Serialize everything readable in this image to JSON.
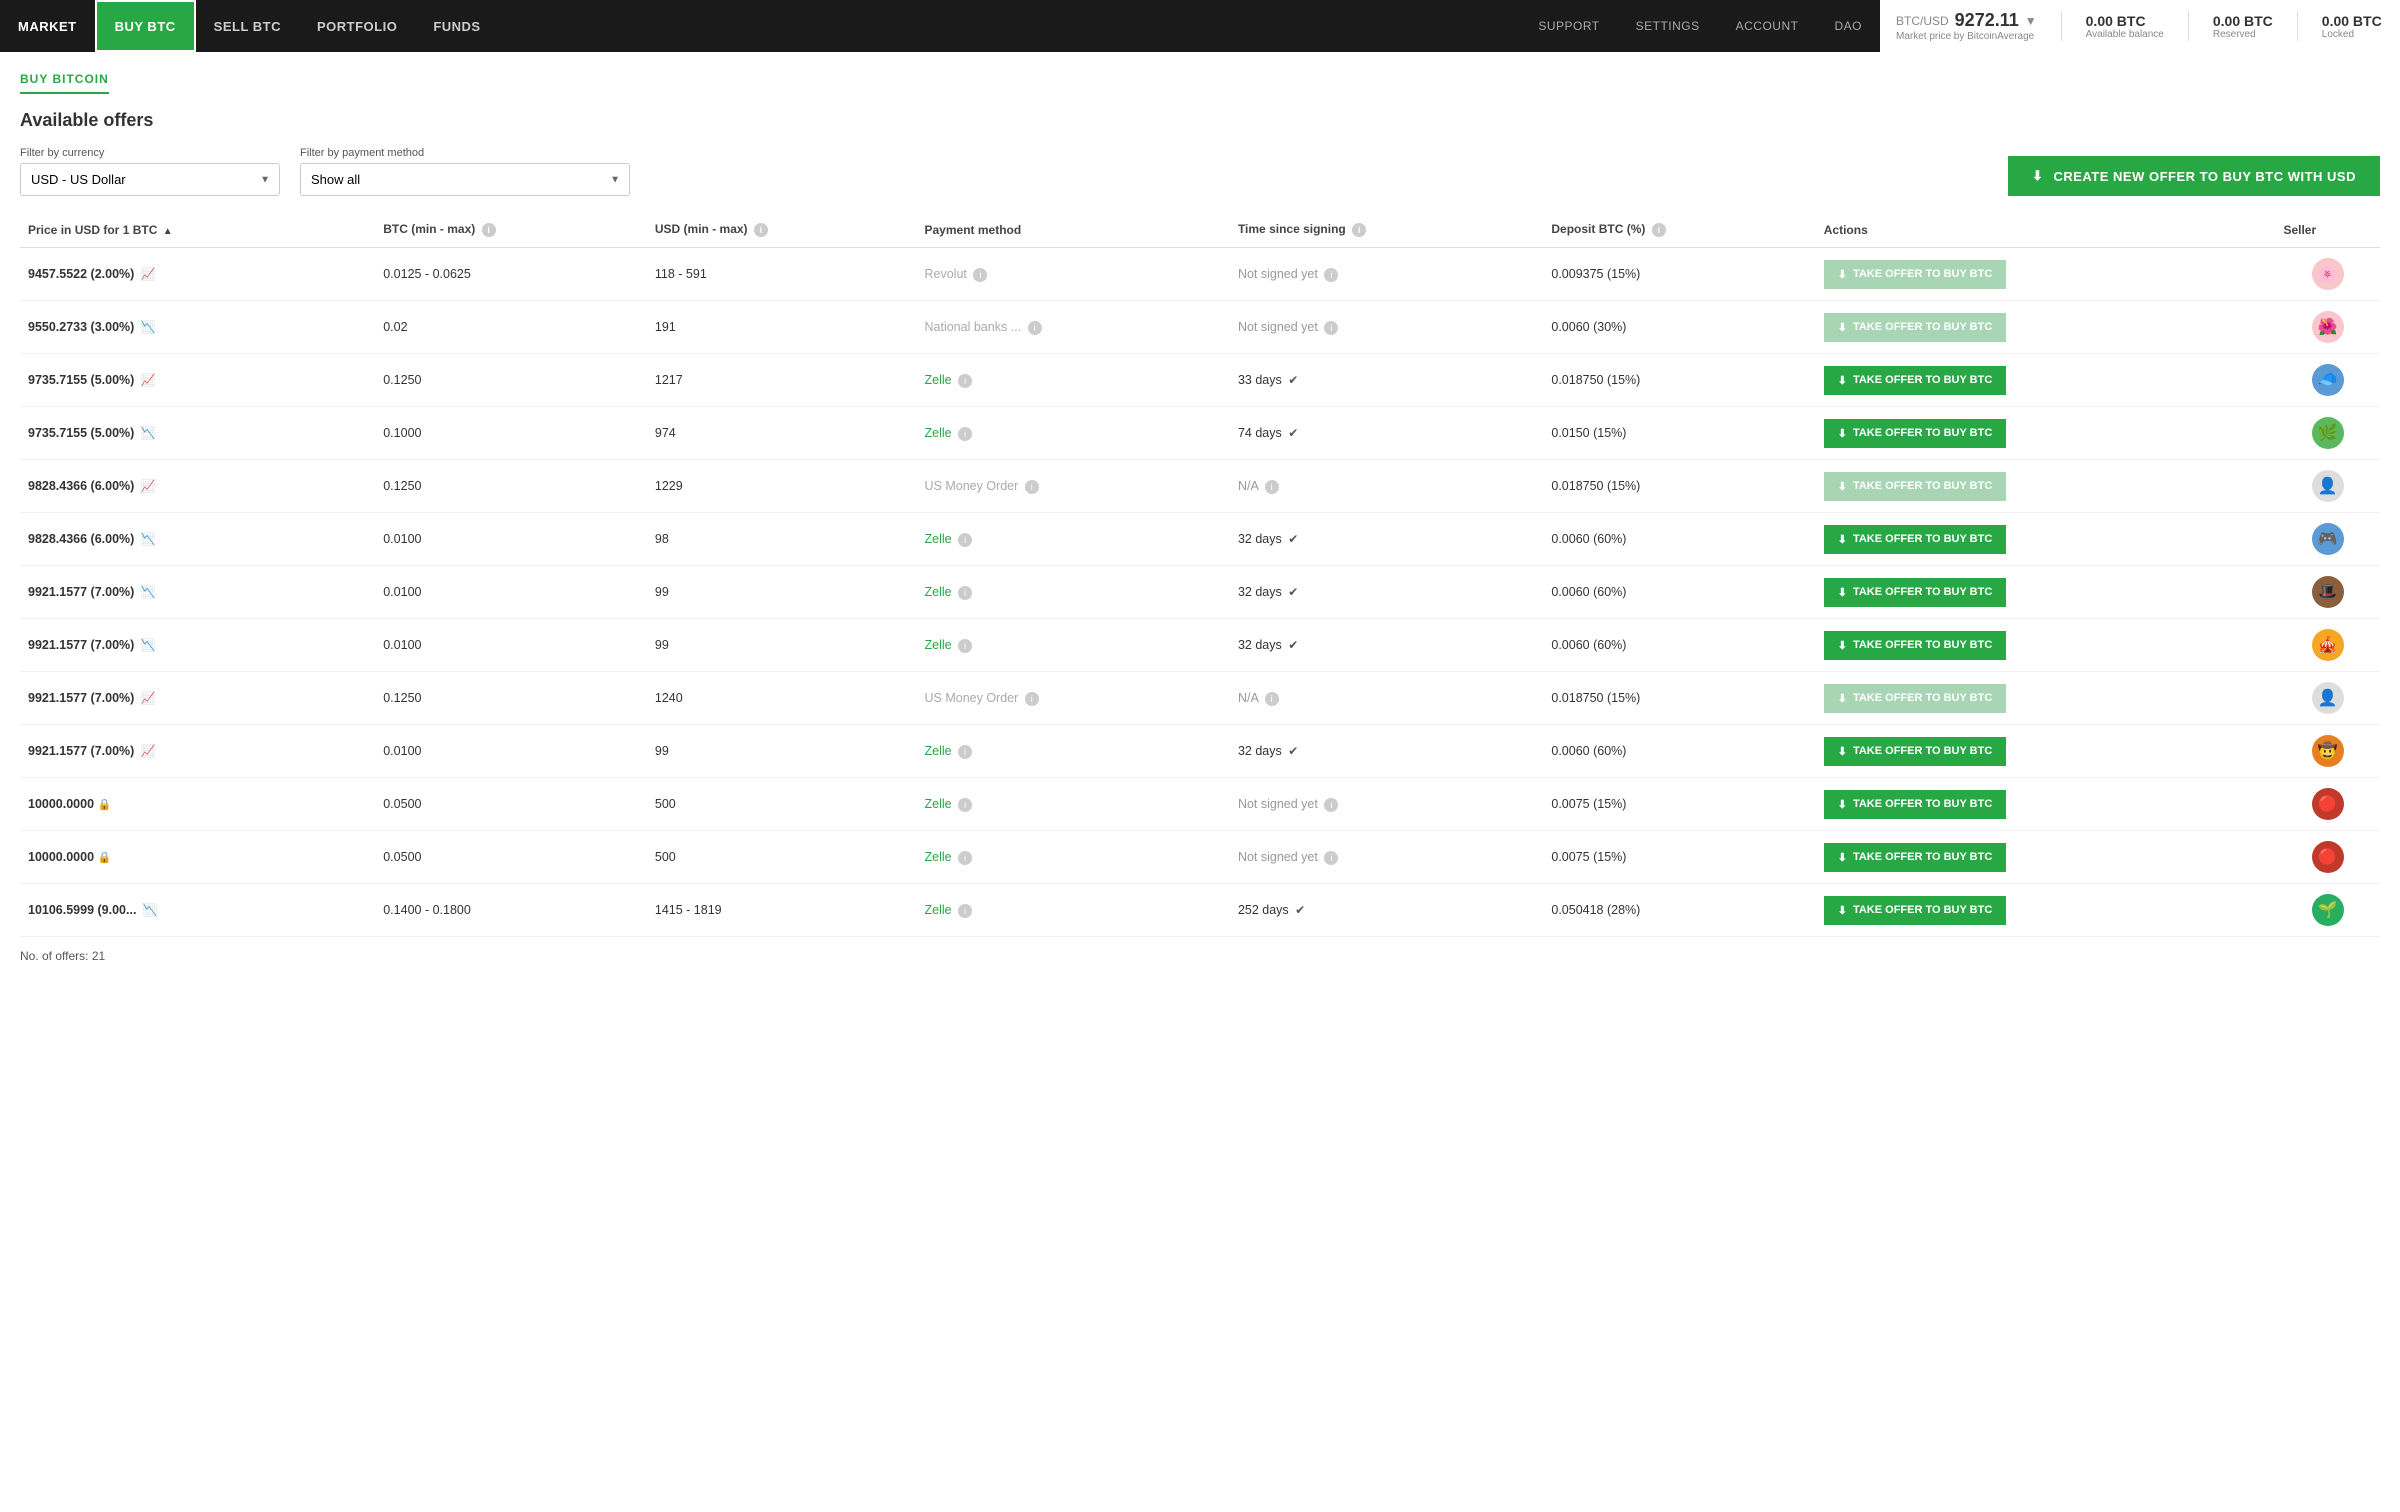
{
  "nav": {
    "links": [
      {
        "label": "MARKET",
        "active": false
      },
      {
        "label": "BUY BTC",
        "active": true
      },
      {
        "label": "SELL BTC",
        "active": false
      },
      {
        "label": "PORTFOLIO",
        "active": false
      },
      {
        "label": "FUNDS",
        "active": false
      }
    ],
    "right_links": [
      {
        "label": "Support"
      },
      {
        "label": "Settings"
      },
      {
        "label": "Account"
      },
      {
        "label": "DAO"
      }
    ]
  },
  "price_widget": {
    "pair": "BTC/USD",
    "price": "9272.11",
    "price_label": "Market price by BitcoinAverage",
    "stats": [
      {
        "value": "0.00 BTC",
        "label": "Available balance"
      },
      {
        "value": "0.00 BTC",
        "label": "Reserved"
      },
      {
        "value": "0.00 BTC",
        "label": "Locked"
      }
    ]
  },
  "breadcrumb": "BUY BITCOIN",
  "section_title": "Available offers",
  "filters": {
    "currency_label": "Filter by currency",
    "currency_value": "USD  -  US Dollar",
    "payment_label": "Filter by payment method",
    "payment_value": "Show all"
  },
  "create_btn": "CREATE NEW OFFER TO BUY BTC WITH USD",
  "table": {
    "headers": [
      "Price in USD for 1 BTC",
      "BTC (min - max)",
      "USD (min - max)",
      "Payment method",
      "Time since signing",
      "Deposit BTC (%)",
      "Actions",
      "Seller"
    ],
    "rows": [
      {
        "price": "9457.5522 (2.00%)",
        "trend": "up",
        "btc": "0.0125 - 0.0625",
        "usd": "118 - 591",
        "payment": "Revolut",
        "payment_active": false,
        "time": "Not signed yet",
        "time_verified": false,
        "deposit": "0.009375 (15%)",
        "btn_disabled": true,
        "avatar": "🌸",
        "avatar_bg": "#f9c6cb"
      },
      {
        "price": "9550.2733 (3.00%)",
        "trend": "down",
        "btc": "0.02",
        "usd": "191",
        "payment": "National banks ...",
        "payment_active": false,
        "time": "Not signed yet",
        "time_verified": false,
        "deposit": "0.0060 (30%)",
        "btn_disabled": true,
        "avatar": "🌺",
        "avatar_bg": "#f9c6cb"
      },
      {
        "price": "9735.7155 (5.00%)",
        "trend": "up",
        "btc": "0.1250",
        "usd": "1217",
        "payment": "Zelle",
        "payment_active": true,
        "time": "33 days",
        "time_verified": true,
        "deposit": "0.018750 (15%)",
        "btn_disabled": false,
        "avatar": "🧢",
        "avatar_bg": "#5b9bd5"
      },
      {
        "price": "9735.7155 (5.00%)",
        "trend": "down",
        "btc": "0.1000",
        "usd": "974",
        "payment": "Zelle",
        "payment_active": true,
        "time": "74 days",
        "time_verified": true,
        "deposit": "0.0150 (15%)",
        "btn_disabled": false,
        "avatar": "🌿",
        "avatar_bg": "#5cb85c"
      },
      {
        "price": "9828.4366 (6.00%)",
        "trend": "up",
        "btc": "0.1250",
        "usd": "1229",
        "payment": "US Money Order",
        "payment_active": false,
        "time": "N/A",
        "time_verified": false,
        "deposit": "0.018750 (15%)",
        "btn_disabled": true,
        "avatar": "👤",
        "avatar_bg": "#ddd"
      },
      {
        "price": "9828.4366 (6.00%)",
        "trend": "down",
        "btc": "0.0100",
        "usd": "98",
        "payment": "Zelle",
        "payment_active": true,
        "time": "32 days",
        "time_verified": true,
        "deposit": "0.0060 (60%)",
        "btn_disabled": false,
        "avatar": "🎮",
        "avatar_bg": "#5b9bd5"
      },
      {
        "price": "9921.1577 (7.00%)",
        "trend": "down",
        "btc": "0.0100",
        "usd": "99",
        "payment": "Zelle",
        "payment_active": true,
        "time": "32 days",
        "time_verified": true,
        "deposit": "0.0060 (60%)",
        "btn_disabled": false,
        "avatar": "🎩",
        "avatar_bg": "#8b5e3c"
      },
      {
        "price": "9921.1577 (7.00%)",
        "trend": "down",
        "btc": "0.0100",
        "usd": "99",
        "payment": "Zelle",
        "payment_active": true,
        "time": "32 days",
        "time_verified": true,
        "deposit": "0.0060 (60%)",
        "btn_disabled": false,
        "avatar": "🎪",
        "avatar_bg": "#f5a623"
      },
      {
        "price": "9921.1577 (7.00%)",
        "trend": "up",
        "btc": "0.1250",
        "usd": "1240",
        "payment": "US Money Order",
        "payment_active": false,
        "time": "N/A",
        "time_verified": false,
        "deposit": "0.018750 (15%)",
        "btn_disabled": true,
        "avatar": "👤",
        "avatar_bg": "#ddd"
      },
      {
        "price": "9921.1577 (7.00%)",
        "trend": "up",
        "btc": "0.0100",
        "usd": "99",
        "payment": "Zelle",
        "payment_active": true,
        "time": "32 days",
        "time_verified": true,
        "deposit": "0.0060 (60%)",
        "btn_disabled": false,
        "avatar": "🤠",
        "avatar_bg": "#e67e22"
      },
      {
        "price": "10000.0000",
        "trend": "lock",
        "btc": "0.0500",
        "usd": "500",
        "payment": "Zelle",
        "payment_active": true,
        "time": "Not signed yet",
        "time_verified": false,
        "deposit": "0.0075 (15%)",
        "btn_disabled": false,
        "avatar": "🔴",
        "avatar_bg": "#c0392b"
      },
      {
        "price": "10000.0000",
        "trend": "lock",
        "btc": "0.0500",
        "usd": "500",
        "payment": "Zelle",
        "payment_active": true,
        "time": "Not signed yet",
        "time_verified": false,
        "deposit": "0.0075 (15%)",
        "btn_disabled": false,
        "avatar": "🔴",
        "avatar_bg": "#c0392b"
      },
      {
        "price": "10106.5999 (9.00...",
        "trend": "down",
        "btc": "0.1400 - 0.1800",
        "usd": "1415 - 1819",
        "payment": "Zelle",
        "payment_active": true,
        "time": "252 days",
        "time_verified": true,
        "deposit": "0.050418 (28%)",
        "btn_disabled": false,
        "avatar": "🌱",
        "avatar_bg": "#27ae60"
      }
    ]
  },
  "offers_count_label": "No. of offers: 21",
  "take_btn_label": "TAKE OFFER TO BUY BTC",
  "colors": {
    "green": "#28a745",
    "green_light": "#a8d5b4"
  }
}
